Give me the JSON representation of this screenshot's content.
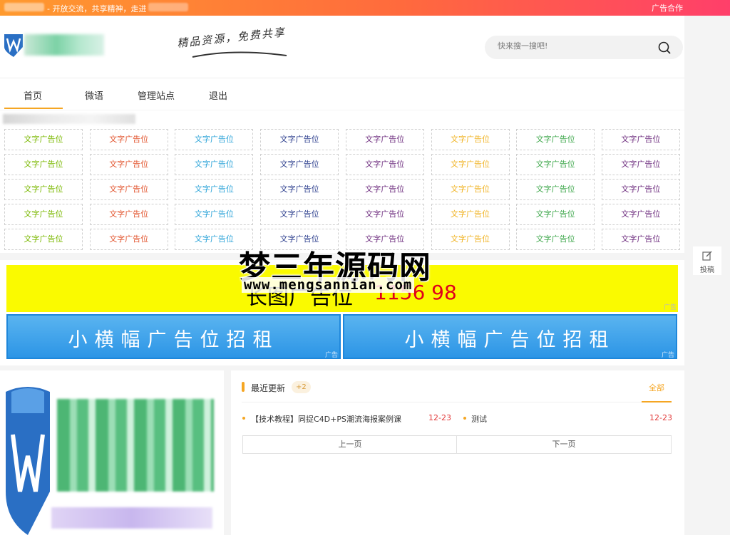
{
  "topbar": {
    "slogan": "- 开放交流，共享精神，走进",
    "ad_link": "广告合作"
  },
  "header": {
    "tagline": "精品资源，免费共享",
    "search_placeholder": "快来搜一搜吧!"
  },
  "nav": {
    "items": [
      "首页",
      "微语",
      "管理站点",
      "退出"
    ],
    "active": "首页"
  },
  "text_ads": {
    "label": "文字广告位",
    "column_colors": [
      "#7ab800",
      "#e2532c",
      "#2aa3d8",
      "#2d3f8e",
      "#6d2c7e",
      "#f0b322",
      "#3fa84c",
      "#6d2c7e"
    ],
    "rows": 5
  },
  "banners": {
    "yellow_text": "长图广告位",
    "yellow_number": "1156 98",
    "ad_tag": "广告",
    "blue_text": "小横幅广告位招租"
  },
  "watermark": {
    "main": "梦三年源码网",
    "sub": "www.mengsannian.com"
  },
  "side": {
    "submit_label": "投稿"
  },
  "recent": {
    "title": "最近更新",
    "badge": "+2",
    "all_link": "全部",
    "items": [
      {
        "title": "【技术教程】同捉C4D+PS潮流海报案例课",
        "date": "12-23"
      },
      {
        "title": "测试",
        "date": "12-23"
      }
    ],
    "prev": "上一页",
    "next": "下一页"
  }
}
